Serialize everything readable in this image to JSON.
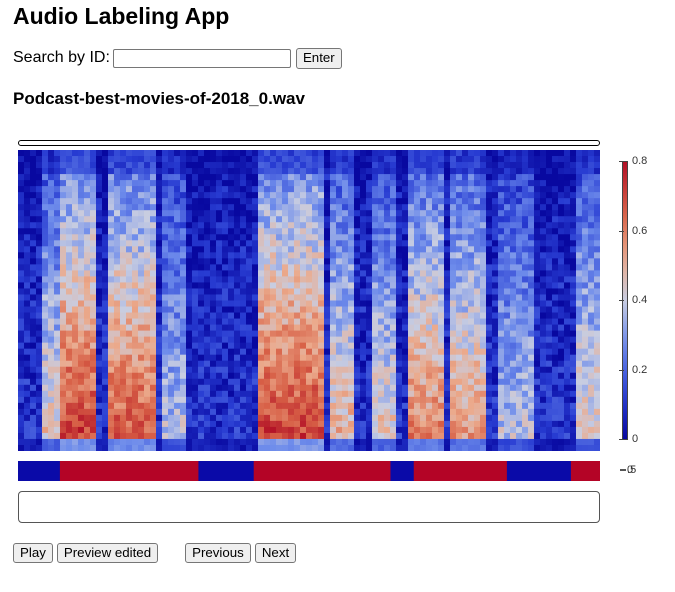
{
  "app": {
    "title": "Audio Labeling App"
  },
  "search": {
    "label": "Search by ID:",
    "value": "",
    "placeholder": "",
    "enter_label": "Enter"
  },
  "file": {
    "name": "Podcast-best-movies-of-2018_0.wav"
  },
  "spectrogram": {
    "colormap": "coolwarm",
    "colorbar_ticks": [
      "0.8",
      "0.6",
      "0.4",
      "0.2",
      "0"
    ],
    "colorbar_range": [
      0,
      0.8
    ]
  },
  "label_strip": {
    "colors": {
      "active": "#b40426",
      "inactive": "#0a0aa8"
    },
    "segments": [
      {
        "label": 0,
        "start": 0.0,
        "end": 0.072
      },
      {
        "label": 1,
        "start": 0.072,
        "end": 0.31
      },
      {
        "label": 0,
        "start": 0.31,
        "end": 0.405
      },
      {
        "label": 1,
        "start": 0.405,
        "end": 0.64
      },
      {
        "label": 0,
        "start": 0.64,
        "end": 0.68
      },
      {
        "label": 1,
        "start": 0.68,
        "end": 0.84
      },
      {
        "label": 0,
        "start": 0.84,
        "end": 0.95
      },
      {
        "label": 1,
        "start": 0.95,
        "end": 1.0
      }
    ],
    "legend_values": [
      "0",
      "1"
    ],
    "legend_tick": ".5"
  },
  "controls": {
    "play_label": "Play",
    "preview_label": "Preview edited",
    "previous_label": "Previous",
    "next_label": "Next"
  }
}
